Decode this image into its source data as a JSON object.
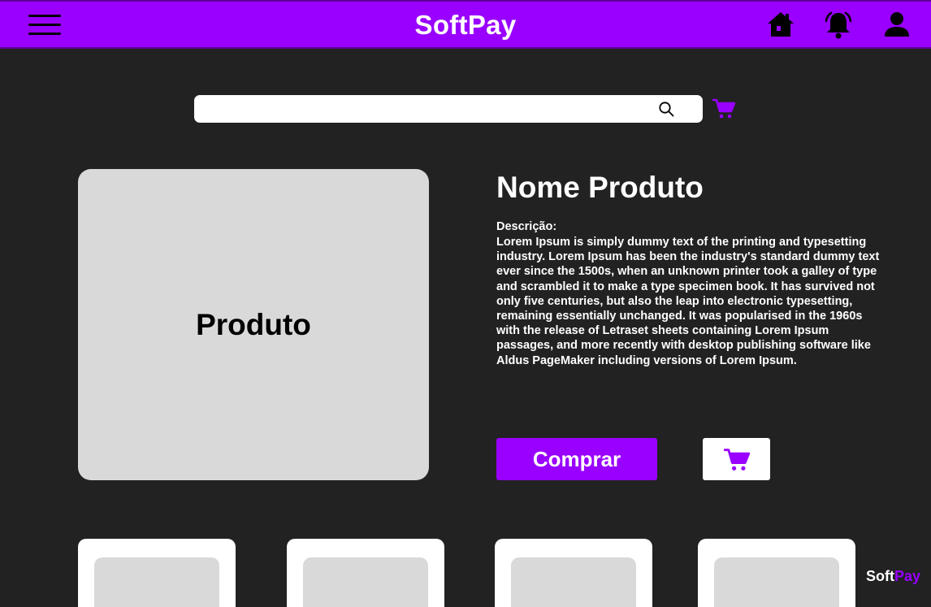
{
  "header": {
    "brand": "SoftPay",
    "icons": [
      "menu-icon",
      "home-icon",
      "bell-icon",
      "user-icon"
    ]
  },
  "search": {
    "value": "",
    "placeholder": "",
    "icon": "search-icon",
    "cart_icon": "cart-icon"
  },
  "product": {
    "image_label": "Produto",
    "name": "Nome Produto",
    "description_label": "Descrição:",
    "description": "Lorem Ipsum is simply dummy text of the printing and typesetting industry. Lorem Ipsum has been the industry's standard dummy text ever since the 1500s, when an unknown printer took a galley of type and scrambled it to make a type specimen book. It has survived not only five centuries, but also the leap into electronic typesetting, remaining essentially unchanged. It was popularised in the 1960s with the release of Letraset sheets containing Lorem Ipsum passages, and more recently with desktop publishing software like Aldus PageMaker including versions of Lorem Ipsum.",
    "buy_label": "Comprar",
    "add_to_cart_icon": "cart-icon"
  },
  "related_products_count": 4,
  "footer": {
    "brand_part1": "Soft",
    "brand_part2": "Pay"
  },
  "colors": {
    "accent": "#9900ff",
    "background": "#222222",
    "placeholder": "#d9d9d9",
    "text": "#ffffff"
  }
}
